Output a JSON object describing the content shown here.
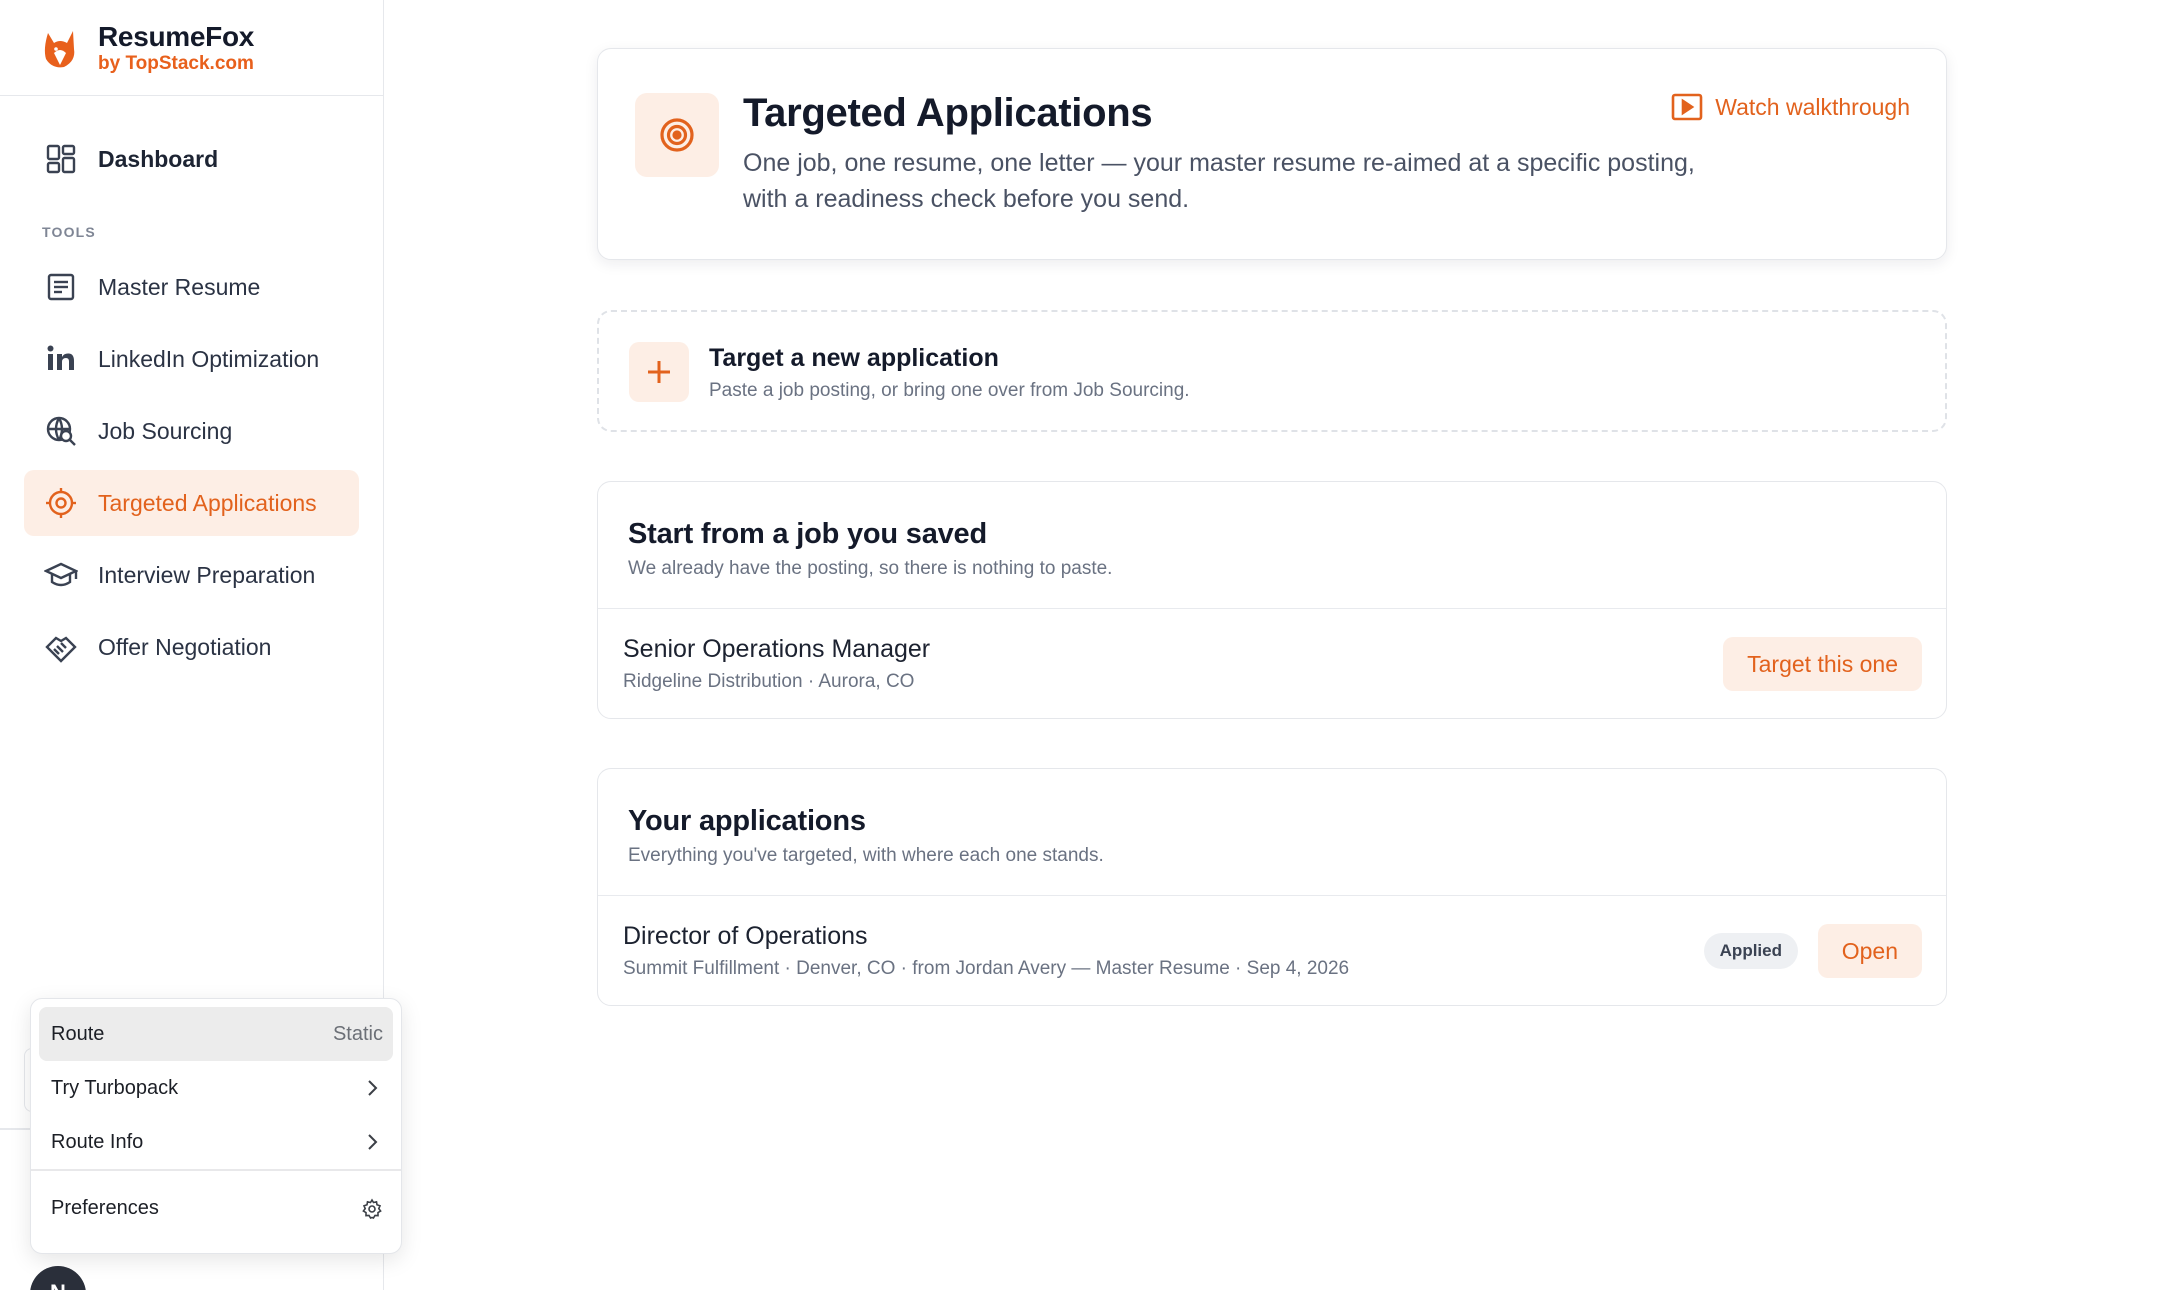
{
  "brand": {
    "name": "ResumeFox",
    "sub": "by TopStack.com"
  },
  "nav": {
    "dashboard": "Dashboard",
    "section": "TOOLS",
    "items": [
      {
        "label": "Master Resume",
        "icon": "document-icon"
      },
      {
        "label": "LinkedIn Optimization",
        "icon": "linkedin-icon"
      },
      {
        "label": "Job Sourcing",
        "icon": "globe-search-icon"
      },
      {
        "label": "Targeted Applications",
        "icon": "target-icon",
        "active": true
      },
      {
        "label": "Interview Preparation",
        "icon": "graduation-cap-icon"
      },
      {
        "label": "Offer Negotiation",
        "icon": "handshake-icon"
      }
    ]
  },
  "dev_menu": {
    "route_label": "Route",
    "route_value": "Static",
    "turbopack": "Try Turbopack",
    "route_info": "Route Info",
    "preferences": "Preferences"
  },
  "avatar": {
    "initial": "N"
  },
  "hero": {
    "title": "Targeted Applications",
    "description": "One job, one resume, one letter — your master resume re-aimed at a specific posting, with a readiness check before you send.",
    "walkthrough": "Watch walkthrough"
  },
  "new_application": {
    "title": "Target a new application",
    "subtitle": "Paste a job posting, or bring one over from Job Sourcing."
  },
  "saved": {
    "title": "Start from a job you saved",
    "subtitle": "We already have the posting, so there is nothing to paste.",
    "jobs": [
      {
        "title": "Senior Operations Manager",
        "meta": "Ridgeline Distribution · Aurora, CO",
        "action": "Target this one"
      }
    ]
  },
  "applications": {
    "title": "Your applications",
    "subtitle": "Everything you've targeted, with where each one stands.",
    "items": [
      {
        "title": "Director of Operations",
        "meta": "Summit Fulfillment · Denver, CO · from Jordan Avery — Master Resume · Sep 4, 2026",
        "status": "Applied",
        "action": "Open"
      }
    ]
  },
  "colors": {
    "accent": "#E2621D",
    "accent_soft": "#FDEEE5"
  }
}
